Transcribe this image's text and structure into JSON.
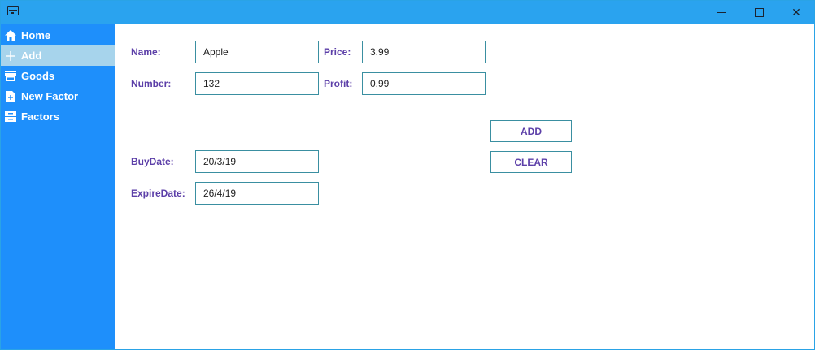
{
  "titlebar": {
    "icon": "app-window-icon",
    "minimize_symbol": "",
    "maximize_symbol": "",
    "close_symbol": "✕"
  },
  "sidebar": {
    "background": "#1e8ffb",
    "active_background": "#a7d4ec",
    "items": [
      {
        "label": "Home",
        "icon": "home-icon"
      },
      {
        "label": "Add",
        "icon": "plus-icon"
      },
      {
        "label": "Goods",
        "icon": "store-icon"
      },
      {
        "label": "New Factor",
        "icon": "new-document-icon"
      },
      {
        "label": "Factors",
        "icon": "cabinet-icon"
      }
    ],
    "active_index": 1
  },
  "form": {
    "name_label": "Name:",
    "name_value": "Apple",
    "price_label": "Price:",
    "price_value": "3.99",
    "number_label": "Number:",
    "number_value": "132",
    "profit_label": "Profit:",
    "profit_value": "0.99",
    "buydate_label": "BuyDate:",
    "buydate_value": "20/3/19",
    "expiredate_label": "ExpireDate:",
    "expiredate_value": "26/4/19"
  },
  "actions": {
    "add_label": "ADD",
    "clear_label": "CLEAR"
  },
  "colors": {
    "titlebar": "#2aa3ef",
    "label": "#5c3fa8",
    "field_border": "#3a8fa1"
  }
}
